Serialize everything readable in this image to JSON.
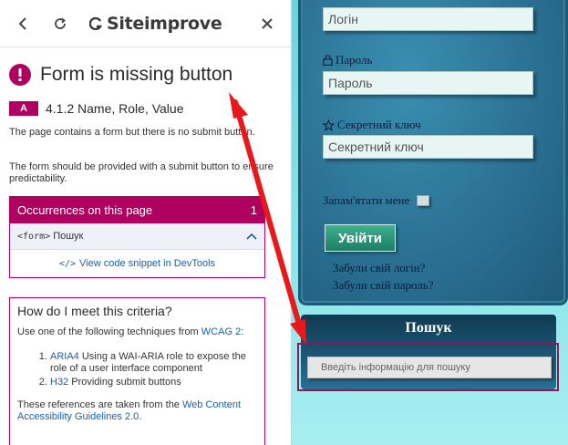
{
  "siteimprove": {
    "brand": "Siteimprove",
    "issue": {
      "title": "Form is missing button",
      "level": "A",
      "criterion": "4.1.2 Name, Role, Value",
      "description": "The page contains a form but there is no submit button.",
      "recommendation": "The form should be provided with a submit button to ensure predictability."
    },
    "occurrences": {
      "header": "Occurrences on this page",
      "count": "1",
      "item_tag": "<form>",
      "item_name": "Пошук",
      "code_link_prefix": "</>",
      "code_link": "View code snippet in DevTools"
    },
    "how_to": {
      "title": "How do I meet this criteria?",
      "intro": "Use one of the following techniques from",
      "intro_link": "WCAG 2",
      "intro_end": ":",
      "techniques": [
        {
          "code": "ARIA4",
          "text": "Using a WAI-ARIA role to expose the role of a user interface component"
        },
        {
          "code": "H32",
          "text": "Providing submit buttons"
        }
      ],
      "ref_prefix": "These references are taken from the",
      "ref_link": "Web Content Accessibility Guidelines 2.0",
      "ref_end": "."
    }
  },
  "site": {
    "login_placeholder": "Логін",
    "password_label": "Пароль",
    "password_placeholder": "Пароль",
    "secret_label": "Секретний ключ",
    "secret_placeholder": "Секретний ключ",
    "remember_label": "Запам'ятати мене",
    "login_button": "Увійти",
    "forgot_login": "Забули свій логін?",
    "forgot_password": "Забули свій пароль?",
    "search_title": "Пошук",
    "search_placeholder": "Введіть інформацію для пошуку"
  },
  "colors": {
    "brand_magenta": "#b0005f",
    "link_blue": "#1a5fa8",
    "annotation_red": "#e8191b"
  }
}
